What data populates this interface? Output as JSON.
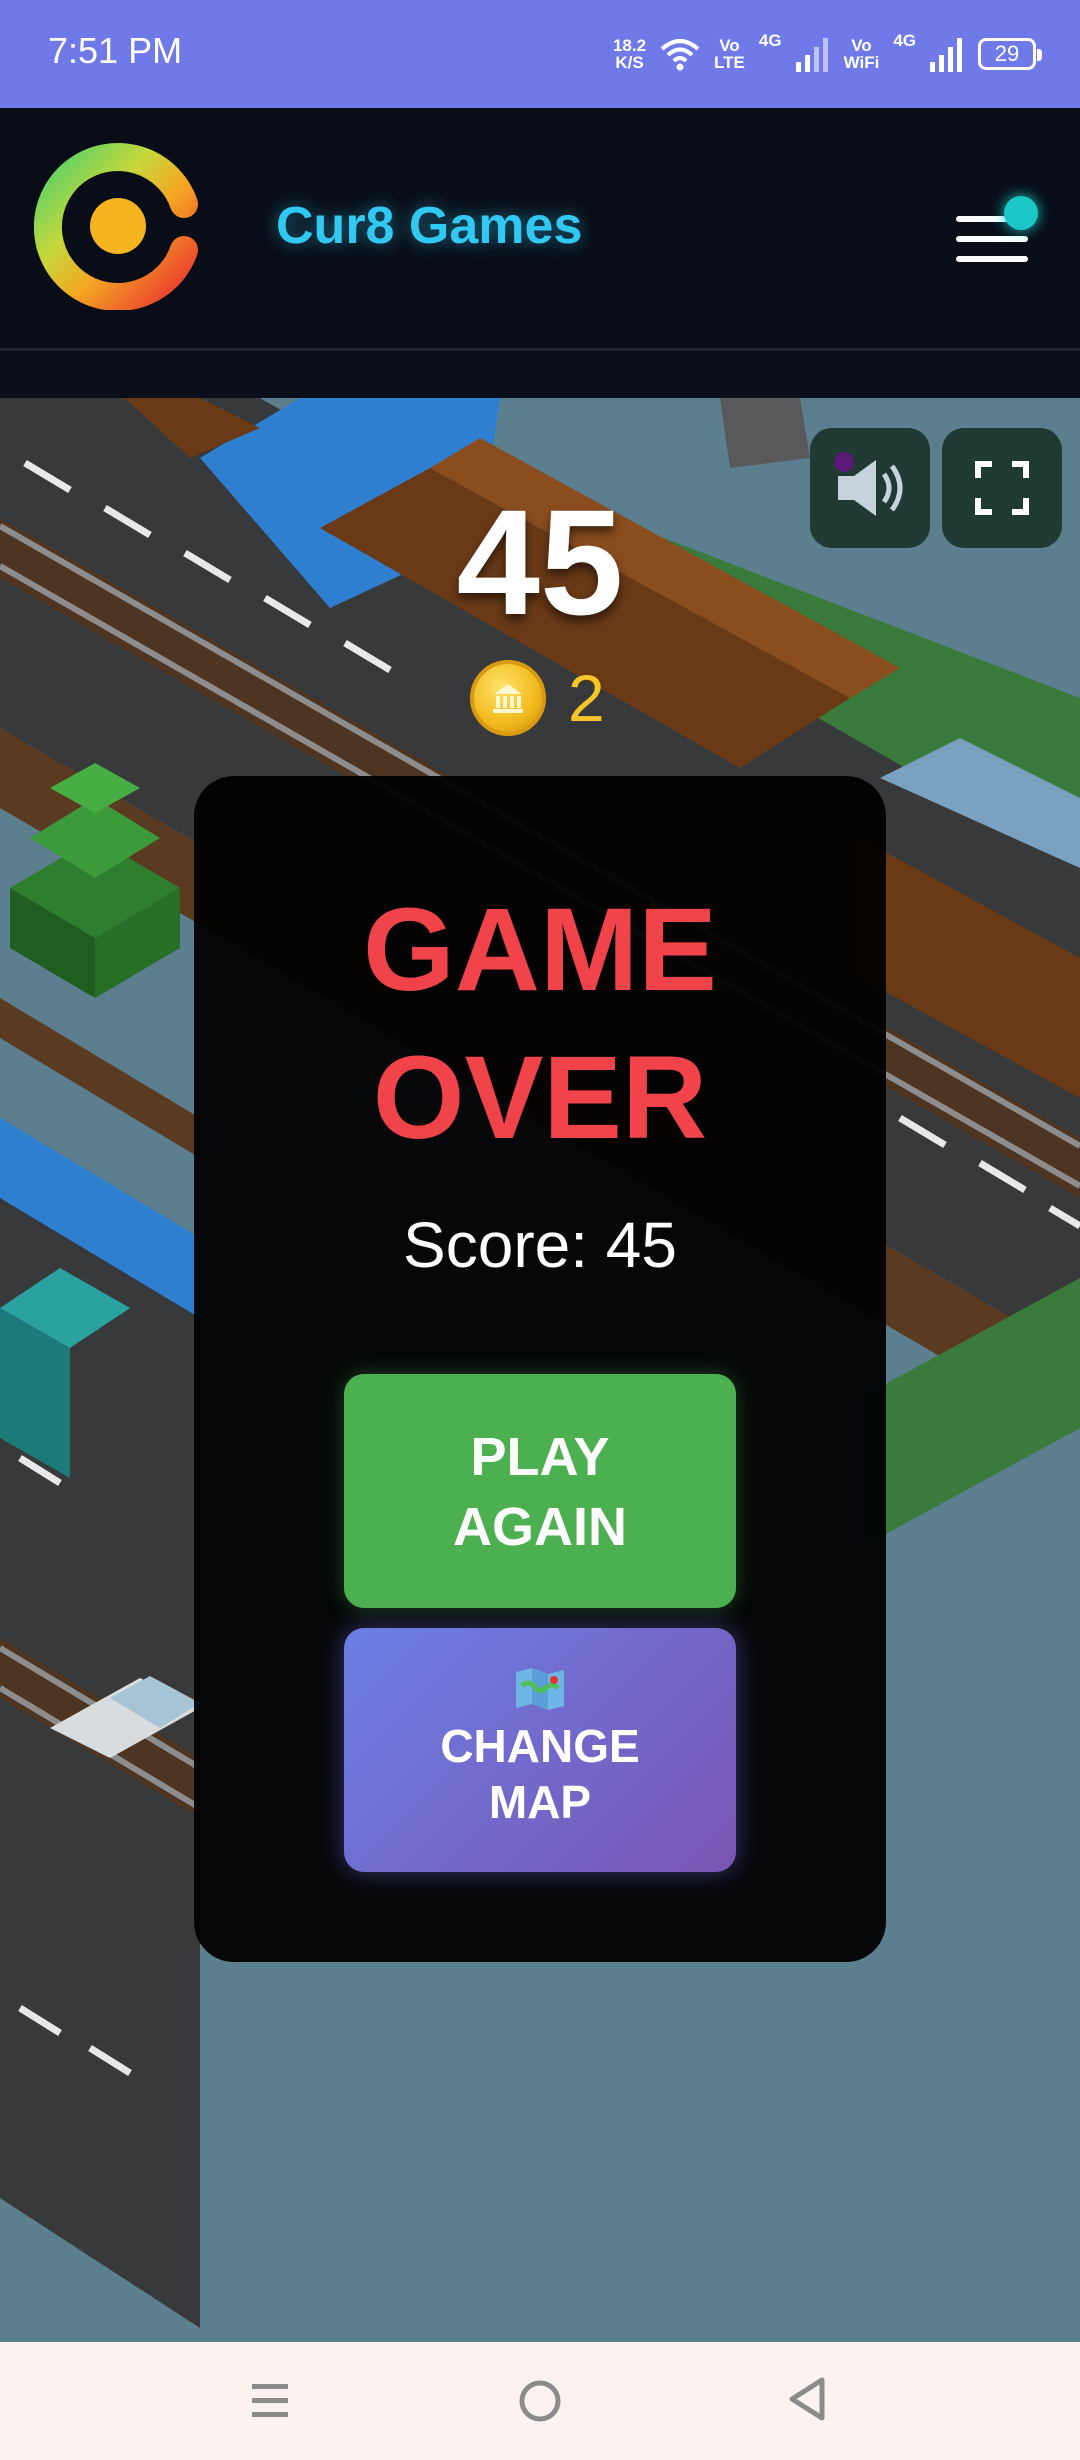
{
  "status_bar": {
    "time": "7:51 PM",
    "net_speed_top": "18.2",
    "net_speed_bottom": "K/S",
    "volte_top": "Vo",
    "volte_bottom": "LTE",
    "sim1_label": "4G",
    "vowifi_top": "Vo",
    "vowifi_bottom": "WiFi",
    "sim2_label": "4G",
    "battery": "29"
  },
  "header": {
    "brand": "Cur8 Games",
    "colors": {
      "brand": "#31c8f2",
      "background": "#090d17",
      "notification_dot": "#1bc6c6"
    }
  },
  "game": {
    "score": "45",
    "coins": "2",
    "controls": {
      "sound_icon": "speaker-icon",
      "fullscreen_icon": "fullscreen-icon"
    }
  },
  "game_over": {
    "title_line1": "GAME",
    "title_line2": "OVER",
    "score_text": "Score: 45",
    "play_again_line1": "PLAY",
    "play_again_line2": "AGAIN",
    "change_map_line1": "CHANGE",
    "change_map_line2": "MAP",
    "colors": {
      "title": "#f0434a",
      "play_again": "#4caf50",
      "change_map_start": "#6b7fe4",
      "change_map_end": "#7a55b3"
    }
  },
  "nav_bar": {
    "items": [
      "menu-icon",
      "home-icon",
      "back-icon"
    ]
  }
}
